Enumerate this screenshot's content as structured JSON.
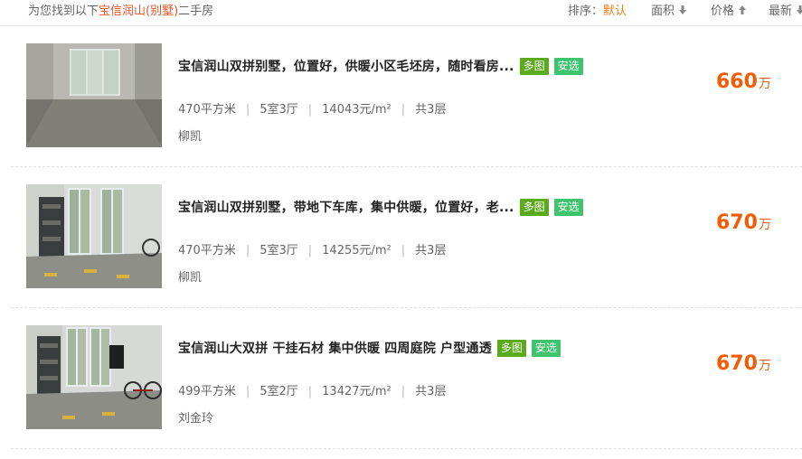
{
  "header": {
    "result_prefix": "为您找到以下",
    "keyword": "宝信润山(别墅)",
    "result_suffix": "二手房",
    "sort_label": "排序：",
    "sort_default": "默认",
    "sort_area": "面积",
    "sort_price": "价格",
    "sort_latest": "最新"
  },
  "listings": [
    {
      "title": "宝信润山双拼别墅，位置好，供暖小区毛坯房，随时看房...",
      "tag_pics": "多图",
      "tag_select": "安选",
      "area": "470平方米",
      "layout": "5室3厅",
      "unit_price": "14043元/m²",
      "floors": "共3层",
      "agent": "柳凯",
      "price": "660",
      "price_unit": "万"
    },
    {
      "title": "宝信润山双拼别墅，带地下车库，集中供暖，位置好，老...",
      "tag_pics": "多图",
      "tag_select": "安选",
      "area": "470平方米",
      "layout": "5室3厅",
      "unit_price": "14255元/m²",
      "floors": "共3层",
      "agent": "柳凯",
      "price": "670",
      "price_unit": "万"
    },
    {
      "title": "宝信润山大双拼 干挂石材 集中供暖 四周庭院 户型通透",
      "tag_pics": "多图",
      "tag_select": "安选",
      "area": "499平方米",
      "layout": "5室2厅",
      "unit_price": "13427元/m²",
      "floors": "共3层",
      "agent": "刘金玲",
      "price": "670",
      "price_unit": "万"
    }
  ],
  "colors": {
    "accent": "#f25c05",
    "keyword": "#e4572e",
    "tag_pics": "#5aaa1c",
    "tag_select": "#3ec46d"
  }
}
